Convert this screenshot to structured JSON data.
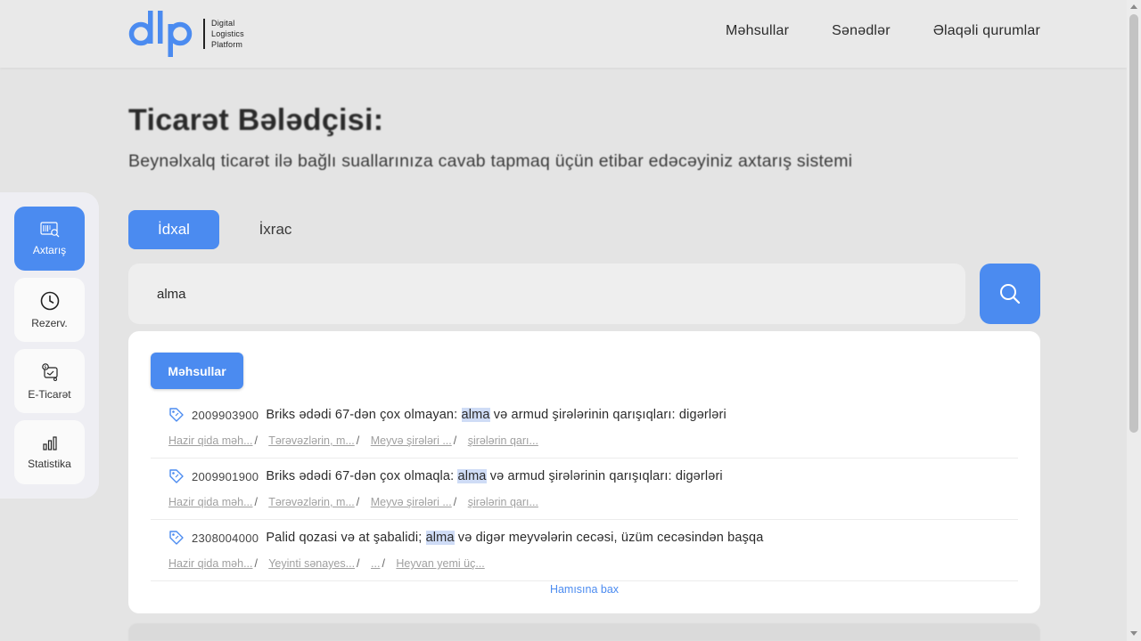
{
  "header": {
    "logo_letters": "dlp",
    "logo_lines": [
      "Digital",
      "Logistics",
      "Platform"
    ],
    "nav": [
      "Məhsullar",
      "Sənədlər",
      "Əlaqəli qurumlar"
    ]
  },
  "page": {
    "title": "Ticarət Bələdçisi:",
    "subtitle": "Beynəlxalq ticarət ilə bağlı suallarınıza cavab tapmaq üçün etibar edəcəyiniz axtarış sistemi"
  },
  "tabs": [
    {
      "label": "İdxal",
      "active": true
    },
    {
      "label": "İxrac",
      "active": false
    }
  ],
  "search": {
    "value": "alma",
    "button_icon": "search-icon"
  },
  "sidebar": {
    "items": [
      {
        "label": "Axtarış",
        "icon": "barcode-search-icon",
        "active": true
      },
      {
        "label": "Rezerv.",
        "icon": "clock-icon",
        "active": false
      },
      {
        "label": "E-Ticarət",
        "icon": "ecommerce-icon",
        "active": false
      },
      {
        "label": "Statistika",
        "icon": "bar-chart-icon",
        "active": false
      }
    ]
  },
  "dropdown": {
    "category_label": "Məhsullar",
    "results": [
      {
        "code": "2009903900",
        "title_before": "Briks ədədi 67-dən çox olmayan: ",
        "highlight": "alma",
        "title_after": " və armud şirələrinin qarışıqları: digərləri",
        "breadcrumbs": [
          "Hazir qida məh...",
          "Tərəvəzlərin, m...",
          "Meyvə şirələri ...",
          " şirələrin qarı..."
        ]
      },
      {
        "code": "2009901900",
        "title_before": "Briks ədədi 67-dən çox olmaqla: ",
        "highlight": "alma",
        "title_after": " və armud şirələrinin qarışıqları: digərləri",
        "breadcrumbs": [
          "Hazir qida məh...",
          "Tərəvəzlərin, m...",
          "Meyvə şirələri ...",
          " şirələrin qarı..."
        ]
      },
      {
        "code": "2308004000",
        "title_before": "Palid qozasi və at şabalidi; ",
        "highlight": "alma",
        "title_after": " və digər meyvələrin cecəsi, üzüm cecəsindən başqa",
        "breadcrumbs": [
          "Hazir qida məh...",
          "Yeyinti sənayes...",
          "...",
          "Heyvan yemi üç..."
        ]
      }
    ],
    "see_all": "Hamısına bax"
  },
  "colors": {
    "accent": "#4b8bf0",
    "highlight": "#cfdcf6",
    "background": "#e4e4e4"
  }
}
